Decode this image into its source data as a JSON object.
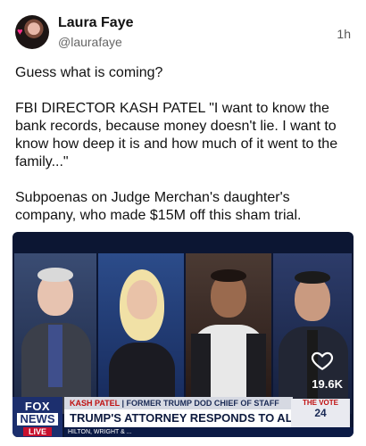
{
  "post": {
    "author_name": "Laura Faye",
    "author_handle": "@laurafaye",
    "time": "1h",
    "paragraphs": [
      "Guess what is coming?",
      "FBI DIRECTOR KASH PATEL \"I want to know the bank records, because money doesn't lie. I want to know how deep it is and how much of it went to the family...\"",
      "Subpoenas on Judge Merchan's daughter's company, who made $15M off this sham trial."
    ]
  },
  "media": {
    "like_count": "19.6K",
    "banner_top_accent": "KASH PATEL",
    "banner_top_rest": "| FORMER TRUMP DOD CHIEF OF STAFF",
    "banner_main": "TRUMP'S ATTORNEY RESPONDS TO ALVIN BRAGG",
    "logo_fox": "FOX",
    "logo_news": "NEWS",
    "logo_live": "LIVE",
    "promo_line1": "THE VOTE",
    "promo_num": "24",
    "ticker_left": "HILTON, WRIGHT & ..."
  },
  "colors": {
    "accent_red": "#c01010",
    "fox_blue": "#1c2f6e"
  }
}
